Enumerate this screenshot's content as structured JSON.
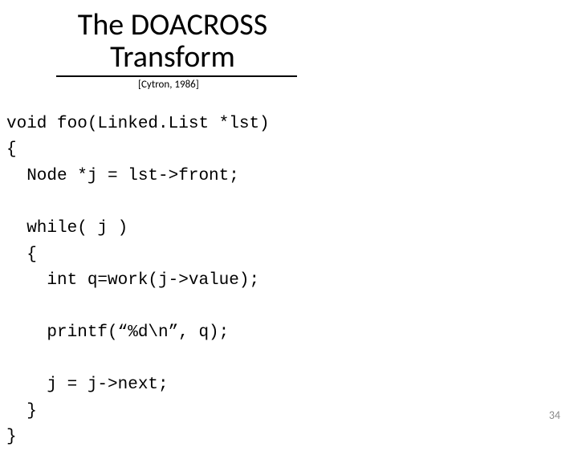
{
  "title_line1": "The DOACROSS",
  "title_line2": "Transform",
  "citation": "[Cytron, 1986]",
  "code": "void foo(Linked.List *lst)\n{\n  Node *j = lst->front;\n\n  while( j )\n  {\n    int q=work(j->value);\n\n    printf(“%d\\n”, q);\n\n    j = j->next;\n  }\n}",
  "page_number": "34"
}
